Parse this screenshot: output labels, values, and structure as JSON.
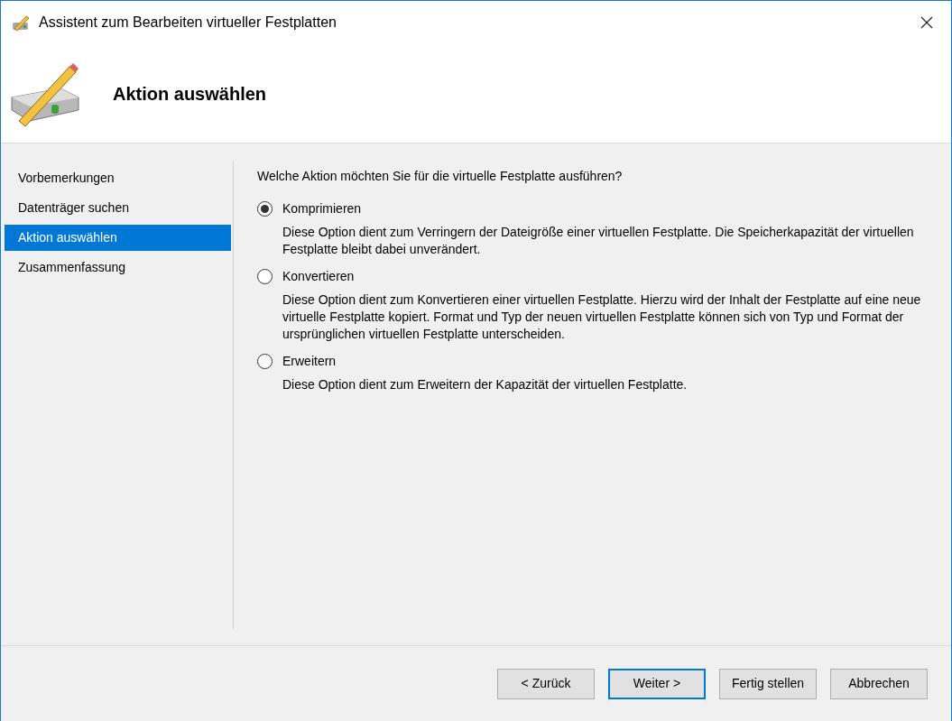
{
  "window": {
    "title": "Assistent zum Bearbeiten virtueller Festplatten"
  },
  "header": {
    "title": "Aktion auswählen"
  },
  "sidebar": {
    "items": [
      {
        "label": "Vorbemerkungen",
        "selected": false
      },
      {
        "label": "Datenträger suchen",
        "selected": false
      },
      {
        "label": "Aktion auswählen",
        "selected": true
      },
      {
        "label": "Zusammenfassung",
        "selected": false
      }
    ]
  },
  "question": "Welche Aktion möchten Sie für die virtuelle Festplatte ausführen?",
  "options": [
    {
      "label": "Komprimieren",
      "selected": true,
      "description": "Diese Option dient zum Verringern der Dateigröße einer virtuellen Festplatte. Die Speicherkapazität der virtuellen Festplatte bleibt dabei unverändert."
    },
    {
      "label": "Konvertieren",
      "selected": false,
      "description": "Diese Option dient zum Konvertieren einer virtuellen Festplatte. Hierzu wird der Inhalt der Festplatte auf eine neue virtuelle Festplatte kopiert. Format und Typ der neuen virtuellen Festplatte können sich von Typ und Format der ursprünglichen virtuellen Festplatte unterscheiden."
    },
    {
      "label": "Erweitern",
      "selected": false,
      "description": "Diese Option dient zum Erweitern der Kapazität der virtuellen Festplatte."
    }
  ],
  "buttons": [
    {
      "label": "< Zurück",
      "default": false
    },
    {
      "label": "Weiter >",
      "default": true
    },
    {
      "label": "Fertig stellen",
      "default": false
    },
    {
      "label": "Abbrechen",
      "default": false
    }
  ]
}
